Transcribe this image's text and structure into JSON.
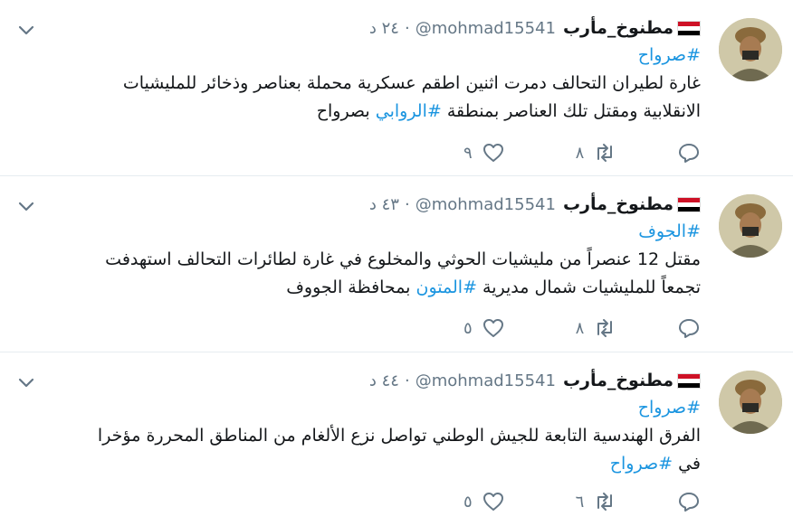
{
  "colors": {
    "link": "#1b95e0",
    "muted": "#657786",
    "text": "#14171a",
    "divider": "#e6ecf0"
  },
  "icons": {
    "reply": "reply-icon",
    "retweet": "retweet-icon",
    "like": "heart-icon",
    "menu": "chevron-down-icon"
  },
  "tweets": [
    {
      "name": "مطنوخ_مأرب",
      "handle": "@mohmad15541",
      "time": "٢٤ د",
      "hashtag_top": "#صرواح",
      "line1": "غارة لطيران التحالف دمرت اثنين اطقم عسكرية محملة بعناصر وذخائر للمليشيات",
      "line2_pre": "الانقلابية ومقتل تلك العناصر بمنطقة ",
      "line2_tag": "#الروابي",
      "line2_post": " بصرواح",
      "retweets": "٨",
      "likes": "٩"
    },
    {
      "name": "مطنوخ_مأرب",
      "handle": "@mohmad15541",
      "time": "٤٣ د",
      "hashtag_top": "#الجوف",
      "line1": "مقتل 12 عنصراً من مليشيات الحوثي والمخلوع في غارة لطائرات التحالف استهدفت",
      "line2_pre": "تجمعاً للمليشيات شمال مديرية ",
      "line2_tag": "#المتون",
      "line2_post": " بمحافظة الجووف",
      "retweets": "٨",
      "likes": "٥"
    },
    {
      "name": "مطنوخ_مأرب",
      "handle": "@mohmad15541",
      "time": "٤٤ د",
      "hashtag_top": "#صرواح",
      "line1": "الفرق الهندسية التابعة للجيش الوطني تواصل نزع الألغام من المناطق المحررة مؤخرا",
      "line2_pre": "في ",
      "line2_tag": "#صرواح",
      "line2_post": "",
      "retweets": "٦",
      "likes": "٥"
    }
  ]
}
